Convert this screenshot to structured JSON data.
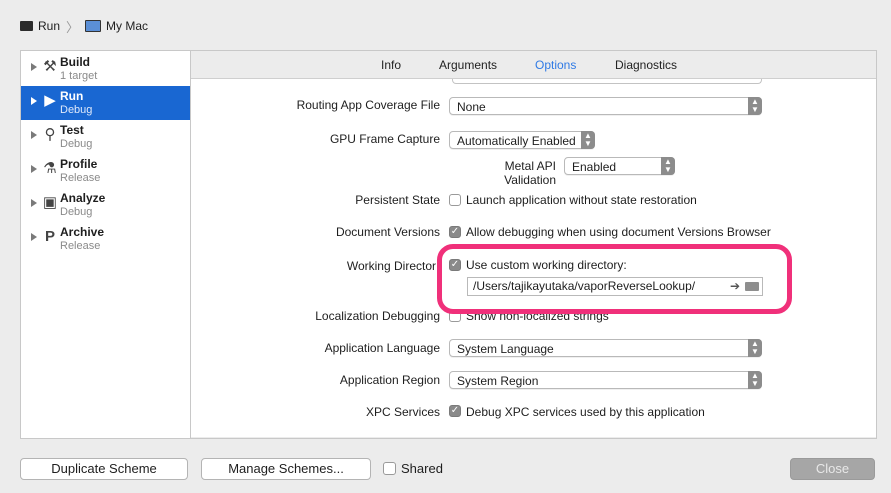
{
  "breadcrumb": {
    "scheme": "Run",
    "destination": "My Mac"
  },
  "sidebar": {
    "items": [
      {
        "name": "Build",
        "sub": "1 target",
        "icon": "hammer-icon",
        "glyph": "⚒"
      },
      {
        "name": "Run",
        "sub": "Debug",
        "icon": "play-icon",
        "glyph": "▶"
      },
      {
        "name": "Test",
        "sub": "Debug",
        "icon": "wrench-icon",
        "glyph": "🔧"
      },
      {
        "name": "Profile",
        "sub": "Release",
        "icon": "instruments-icon",
        "glyph": "⚗"
      },
      {
        "name": "Analyze",
        "sub": "Debug",
        "icon": "analyze-icon",
        "glyph": "▣"
      },
      {
        "name": "Archive",
        "sub": "Release",
        "icon": "archive-icon",
        "glyph": "P"
      }
    ]
  },
  "tabs": {
    "info": "Info",
    "arguments": "Arguments",
    "options": "Options",
    "diagnostics": "Diagnostics"
  },
  "options": {
    "routing_label": "Routing App Coverage File",
    "routing_value": "None",
    "gpu_label": "GPU Frame Capture",
    "gpu_value": "Automatically Enabled",
    "metal_label": "Metal API Validation",
    "metal_value": "Enabled",
    "persistent_label": "Persistent State",
    "persistent_check": "Launch application without state restoration",
    "docver_label": "Document Versions",
    "docver_check": "Allow debugging when using document Versions Browser",
    "workdir_label": "Working Director",
    "workdir_check": "Use custom working directory:",
    "workdir_path": "/Users/tajikayutaka/vaporReverseLookup/",
    "locdebug_label": "Localization Debugging",
    "locdebug_check": "Show non-localized strings",
    "applang_label": "Application Language",
    "applang_value": "System Language",
    "appregion_label": "Application Region",
    "appregion_value": "System Region",
    "xpc_label": "XPC Services",
    "xpc_check": "Debug XPC services used by this application"
  },
  "footer": {
    "duplicate": "Duplicate Scheme",
    "manage": "Manage Schemes...",
    "shared": "Shared",
    "close": "Close"
  },
  "colors": {
    "selection": "#1967d2",
    "accent_tab": "#2f7ae5",
    "highlight": "#f0307a"
  }
}
